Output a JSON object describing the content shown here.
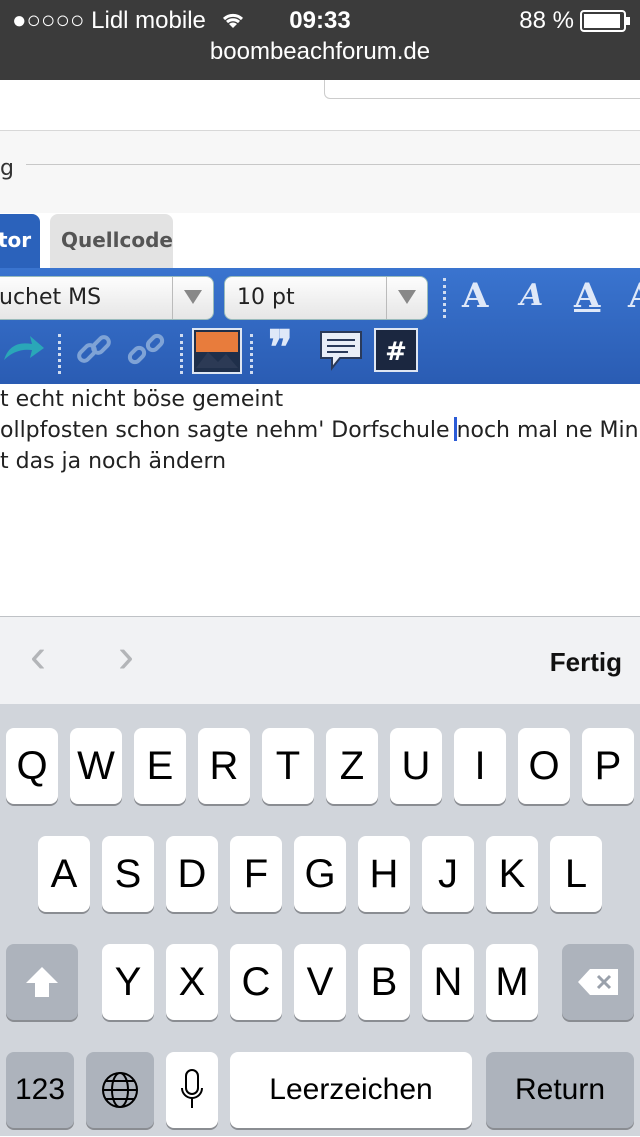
{
  "status_bar": {
    "carrier": "●○○○○ Lidl mobile",
    "time": "09:33",
    "battery": "88 %",
    "url": "boombeachforum.de"
  },
  "page": {
    "legend_fragment": "g",
    "tabs": {
      "editor": "tor",
      "source": "Quellcode"
    },
    "font_select": "uchet MS",
    "size_select": "10 pt",
    "text_lines": [
      "t echt nicht böse gemeint",
      "ollpfosten schon sagte nehm' Dorfschule",
      "noch mal ne Min",
      "t das ja noch ändern"
    ]
  },
  "accessory": {
    "done": "Fertig"
  },
  "keyboard": {
    "row1": [
      "Q",
      "W",
      "E",
      "R",
      "T",
      "Z",
      "U",
      "I",
      "O",
      "P"
    ],
    "row2": [
      "A",
      "S",
      "D",
      "F",
      "G",
      "H",
      "J",
      "K",
      "L"
    ],
    "row3": [
      "Y",
      "X",
      "C",
      "V",
      "B",
      "N",
      "M"
    ],
    "numbers": "123",
    "space": "Leerzeichen",
    "return": "Return"
  },
  "colors": {
    "toolbar_blue": "#2f66c1",
    "status_bar": "#3b3b3b",
    "keyboard_bg": "#d1d5db"
  },
  "icons": [
    "wifi-icon",
    "battery-icon",
    "redo-icon",
    "link-icon",
    "unlink-icon",
    "image-icon",
    "quote-icon",
    "comment-icon",
    "hash-icon",
    "back-chevron-icon",
    "forward-chevron-icon",
    "shift-icon",
    "backspace-icon",
    "globe-icon",
    "microphone-icon"
  ]
}
